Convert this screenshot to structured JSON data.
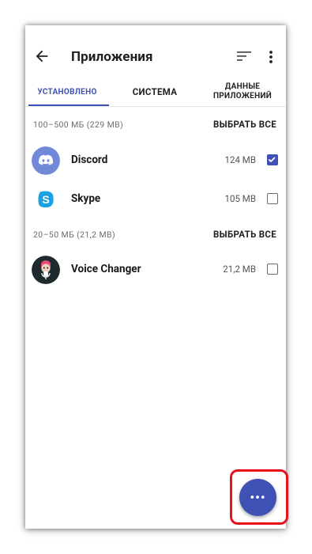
{
  "toolbar": {
    "title": "Приложения",
    "back_icon": "arrow-back-icon",
    "sort_icon": "sort-icon",
    "menu_icon": "more-vert-icon"
  },
  "tabs": [
    {
      "label": "УСТАНОВЛЕНО",
      "active": true
    },
    {
      "label": "СИСТЕМА",
      "active": false
    },
    {
      "label": "ДАННЫЕ ПРИЛОЖЕНИЙ",
      "active": false
    }
  ],
  "groups": [
    {
      "title": "100–500 МБ (229 MB)",
      "select_all": "ВЫБРАТЬ ВСЕ",
      "apps": [
        {
          "name": "Discord",
          "size": "124 MB",
          "checked": true,
          "icon": "discord-icon"
        },
        {
          "name": "Skype",
          "size": "105 MB",
          "checked": false,
          "icon": "skype-icon"
        }
      ]
    },
    {
      "title": "20–50 МБ (21,2 MB)",
      "select_all": "ВЫБРАТЬ ВСЕ",
      "apps": [
        {
          "name": "Voice Changer",
          "size": "21,2 MB",
          "checked": false,
          "icon": "voice-changer-icon"
        }
      ]
    }
  ],
  "fab": {
    "label": "•••",
    "icon": "more-horiz-icon"
  },
  "colors": {
    "accent": "#3f51b5",
    "highlight": "#e8121b",
    "discord": "#7289da",
    "skype": "#1ba1e2"
  }
}
